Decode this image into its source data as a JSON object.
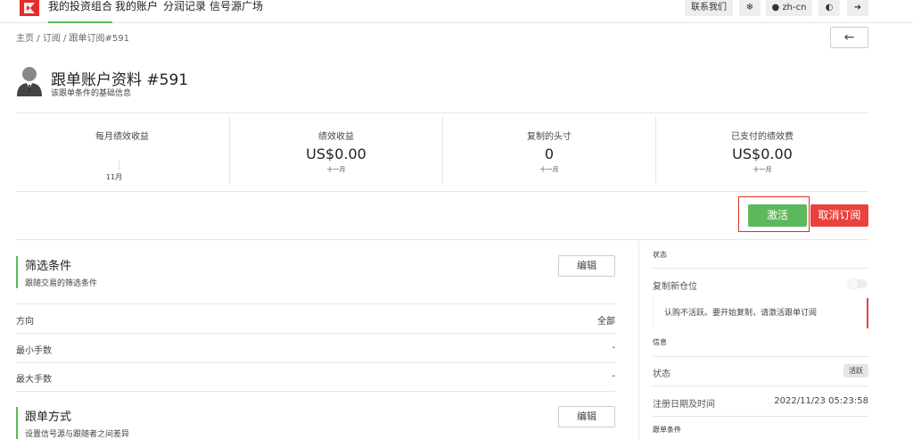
{
  "nav": {
    "items": [
      "我的投资组合",
      "我的账户",
      "分润记录",
      "信号源广场"
    ],
    "contact": "联系我们",
    "snow_icon": "snowflake-icon",
    "lang": "zh-cn",
    "theme_icon": "contrast-icon",
    "logout_icon": "logout-icon"
  },
  "breadcrumb": {
    "home": "主页",
    "sep": "/",
    "subs": "订阅",
    "current": "跟单订阅#591"
  },
  "back_icon": "arrow-left-icon",
  "header": {
    "title": "跟单账户资料 #591",
    "subtitle": "该跟单条件的基础信息"
  },
  "stats": [
    {
      "label": "每月绩效收益",
      "value": "",
      "sub": ""
    },
    {
      "label": "绩效收益",
      "value": "US$0.00",
      "sub": "十一月"
    },
    {
      "label": "复制的头寸",
      "value": "0",
      "sub": "十一月"
    },
    {
      "label": "已支付的绩效费",
      "value": "US$0.00",
      "sub": "十一月"
    }
  ],
  "chart_month": "11月",
  "actions": {
    "activate": "激活",
    "unsubscribe": "取消订阅"
  },
  "filter": {
    "title": "筛选条件",
    "desc": "跟随交易的筛选条件",
    "edit": "编辑",
    "rows": [
      {
        "label": "方向",
        "value": "全部"
      },
      {
        "label": "最小手数",
        "value": "-"
      },
      {
        "label": "最大手数",
        "value": "-"
      }
    ]
  },
  "copy_mode": {
    "title": "跟单方式",
    "desc": "设置信号源与跟随者之间差异",
    "edit": "编辑"
  },
  "right": {
    "status_title": "状态",
    "copy_new": "复制新仓位",
    "copy_new_enabled": false,
    "alert": "认购不活跃。要开始复制，请激活跟单订阅",
    "info_title": "信息",
    "status_label": "状态",
    "status_badge": "活跃",
    "reg_label": "注册日期及时间",
    "reg_value": "2022/11/23 05:23:58",
    "conditions_title": "跟单条件"
  },
  "colors": {
    "accent": "#5cb85c",
    "danger": "#e9413c",
    "brand": "#e52b2b"
  }
}
